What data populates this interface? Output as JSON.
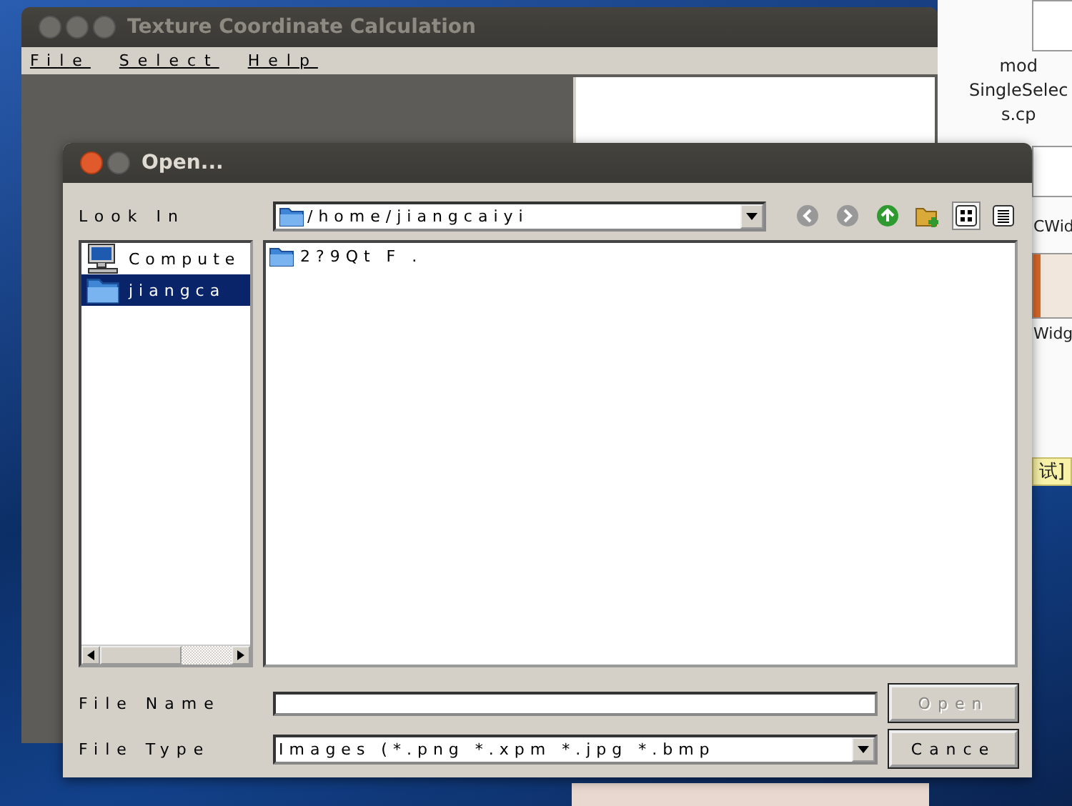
{
  "background_window": {
    "title": "Texture Coordinate Calculation",
    "menu": [
      "File",
      "Select",
      "Help"
    ]
  },
  "desktop_icons": [
    {
      "kind": "document",
      "lines": [
        "mod",
        "SingleSelec",
        "s.cp"
      ]
    },
    {
      "kind": "document",
      "lines": [
        "CWid"
      ]
    },
    {
      "kind": "image",
      "lines": [
        "Widg"
      ]
    },
    {
      "kind": "tooltip",
      "lines": [
        "试]"
      ]
    }
  ],
  "dialog": {
    "title": "Open...",
    "look_in_label": "Look In",
    "path": "/home/jiangcaiyi",
    "toolbar": [
      {
        "kind": "back",
        "disabled": true
      },
      {
        "kind": "forward",
        "disabled": true
      },
      {
        "kind": "up",
        "disabled": false
      },
      {
        "kind": "new-folder",
        "disabled": false
      }
    ],
    "view_modes": [
      {
        "kind": "icons",
        "selected": true
      },
      {
        "kind": "details",
        "selected": false
      }
    ],
    "sidebar": [
      {
        "kind": "computer",
        "label": "Compute",
        "selected": false
      },
      {
        "kind": "folder",
        "label": "jiangca",
        "selected": true
      }
    ],
    "files": [
      {
        "name": "2?9Qt F ."
      }
    ],
    "file_name_label": "File Name",
    "file_type_label": "File Type",
    "file_type": "Images (*.png *.xpm *.jpg *.bmp",
    "buttons": [
      {
        "label": "Open",
        "disabled": true
      },
      {
        "label": "Cance",
        "disabled": false
      }
    ]
  }
}
